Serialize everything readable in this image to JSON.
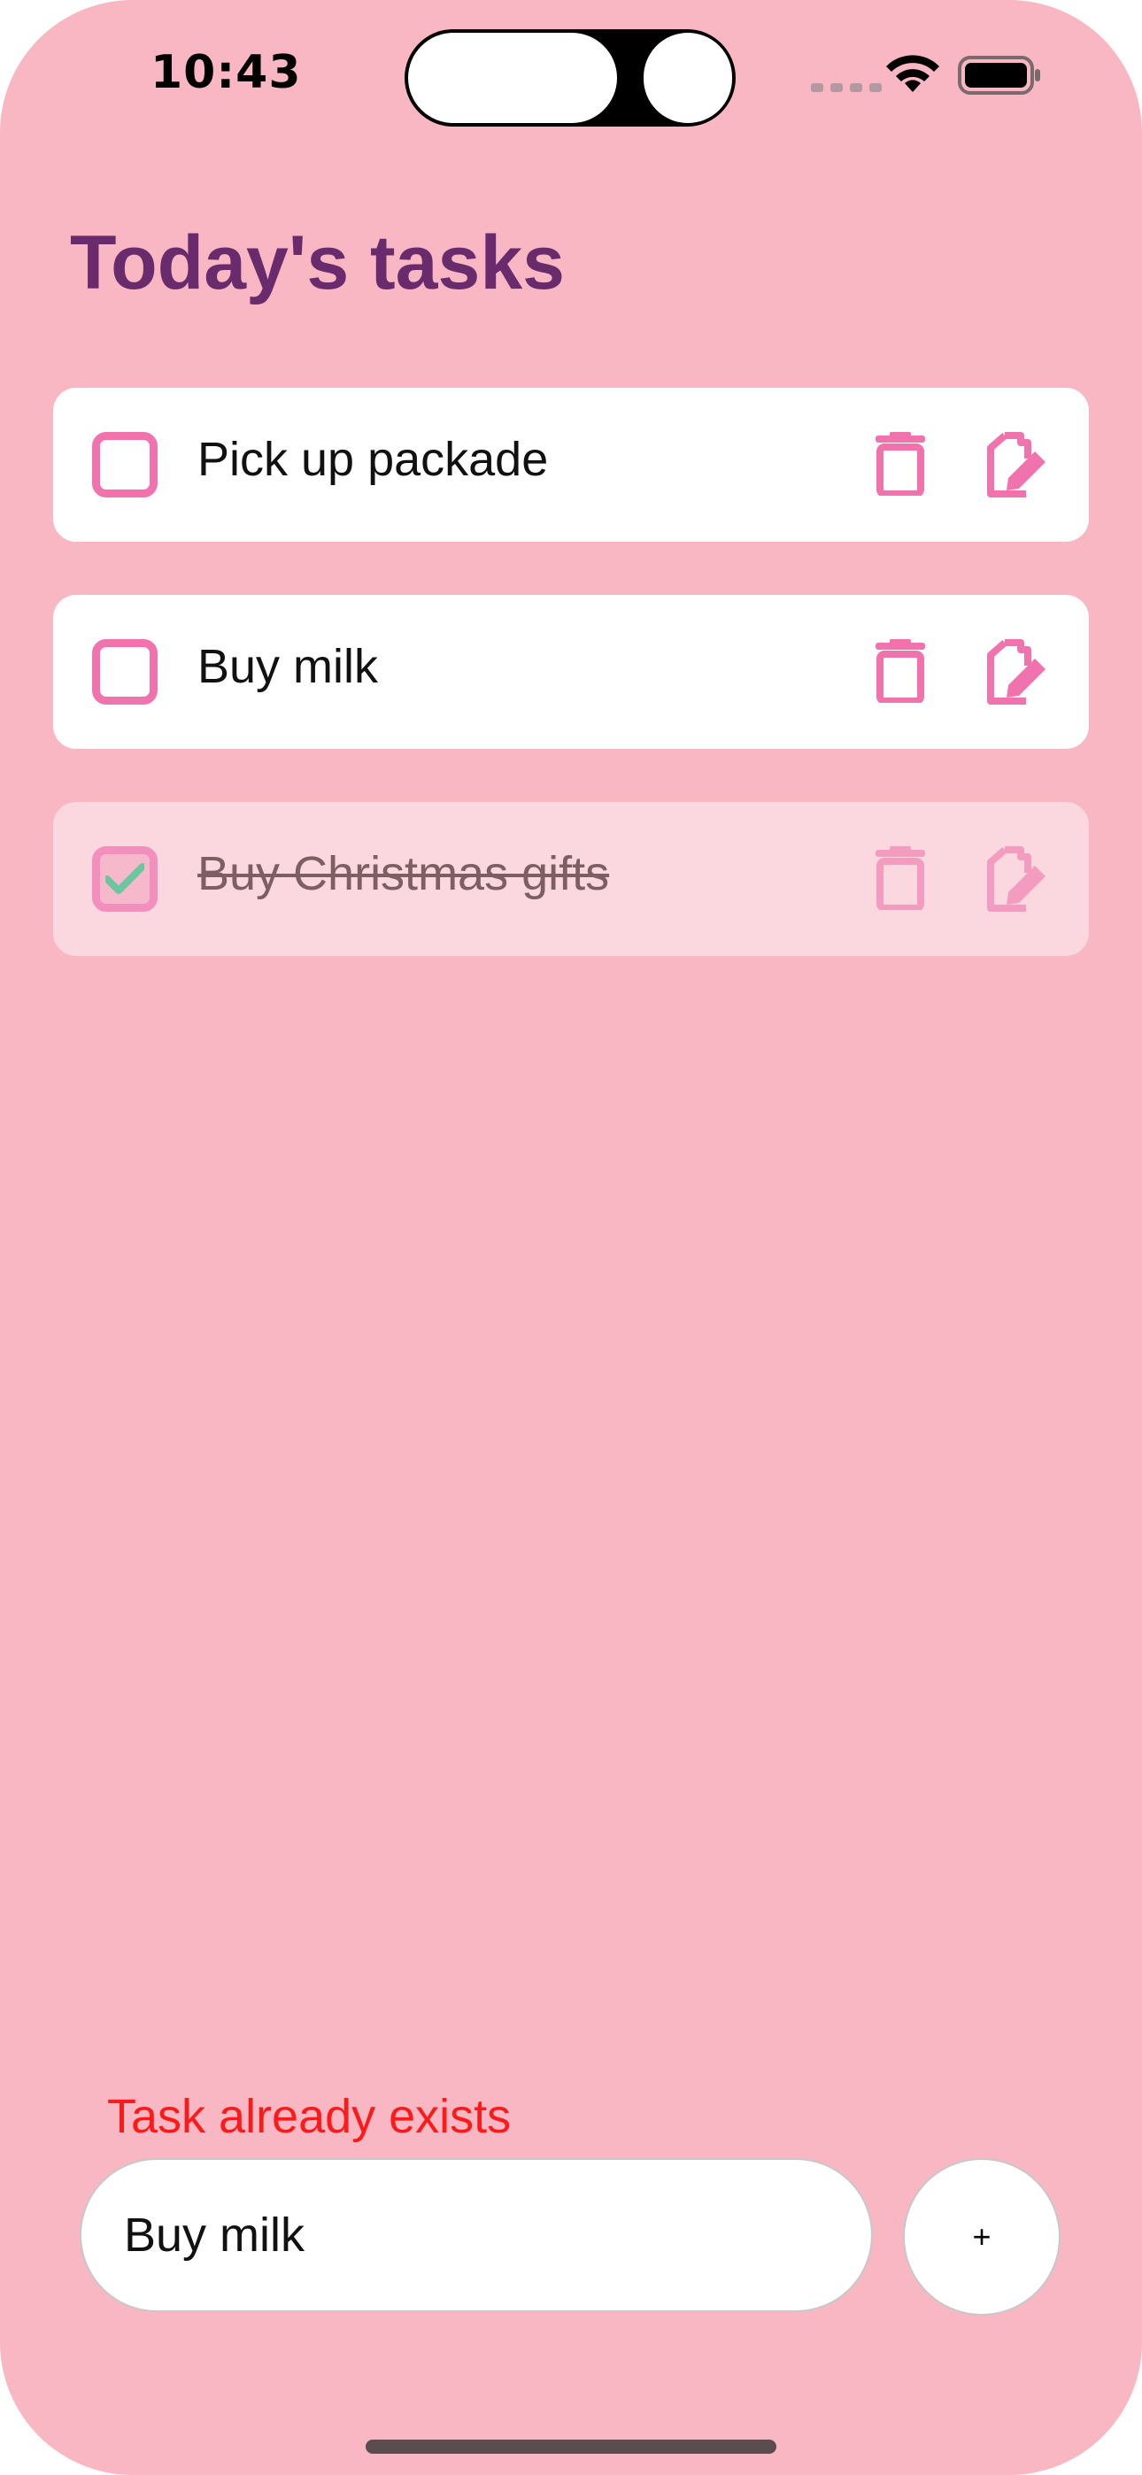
{
  "status_bar": {
    "time": "10:43"
  },
  "page": {
    "title": "Today's tasks"
  },
  "tasks": [
    {
      "label": "Pick up packade",
      "done": false
    },
    {
      "label": "Buy milk",
      "done": false
    },
    {
      "label": "Buy Christmas gifts",
      "done": true
    }
  ],
  "footer": {
    "error_message": "Task already exists",
    "input_value": "Buy milk",
    "add_label": "+"
  },
  "colors": {
    "background": "#f8b7c2",
    "accent": "#f073ad",
    "title": "#6a2b6c",
    "error": "#ff1a1a",
    "check": "#6cc7a0"
  },
  "icons": [
    "wifi-icon",
    "battery-icon",
    "trash-icon",
    "edit-icon",
    "checkmark-icon"
  ]
}
